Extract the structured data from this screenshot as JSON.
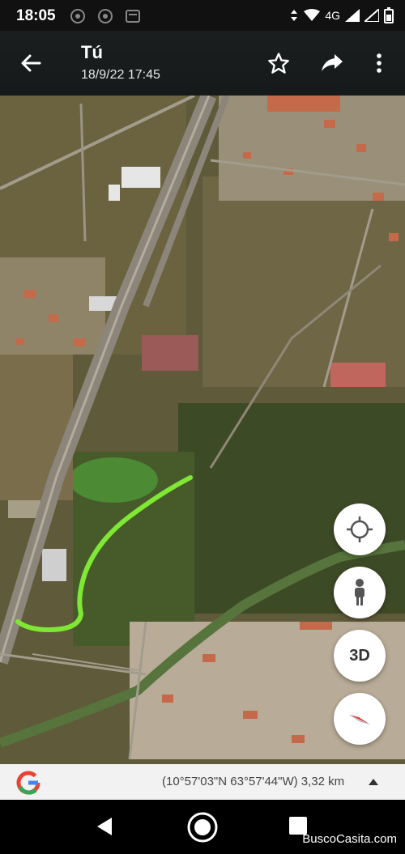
{
  "status": {
    "time": "18:05",
    "network": "4G"
  },
  "header": {
    "title": "Tú",
    "subtitle": "18/9/22 17:45"
  },
  "map": {
    "route_color": "#7ee835",
    "controls": {
      "three_d_label": "3D"
    }
  },
  "info_bar": {
    "coordinates": "(10°57'03\"N 63°57'44\"W) 3,32 km"
  },
  "watermark": "BuscoCasita.com"
}
